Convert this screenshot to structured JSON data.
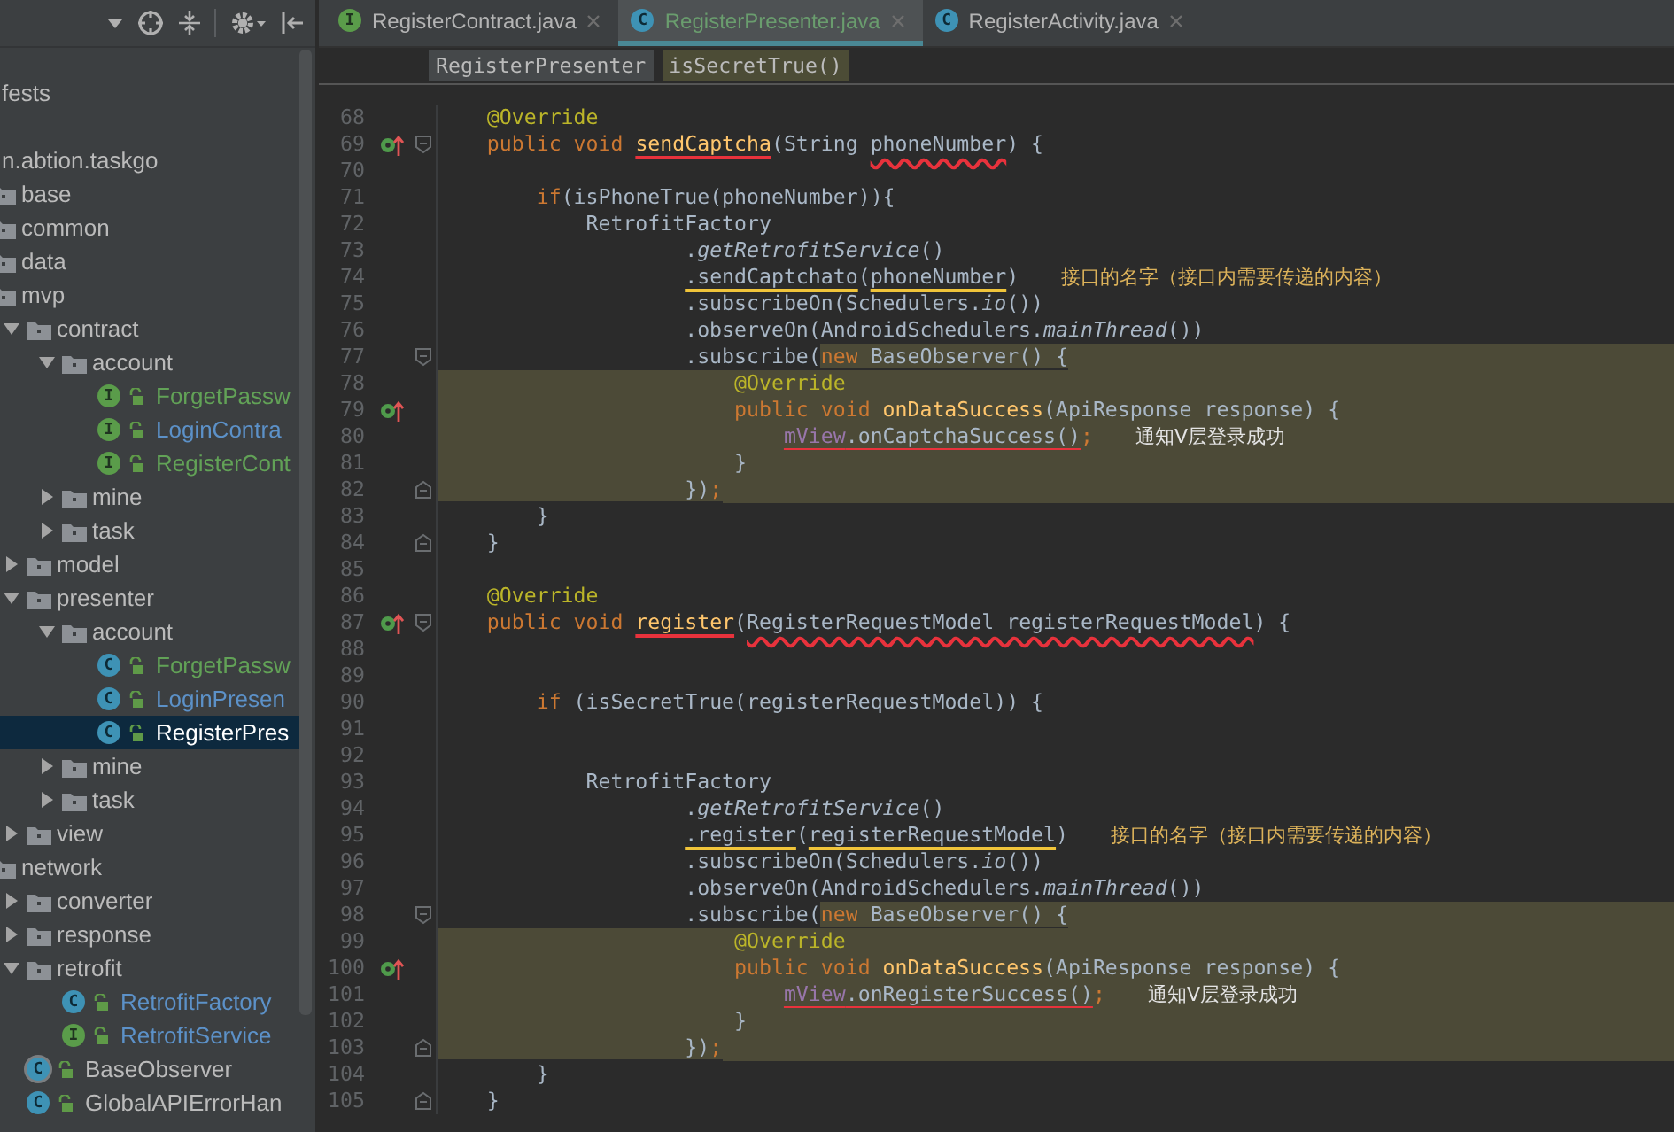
{
  "tree": [
    {
      "label": "fests",
      "kind": "label",
      "selected": false
    },
    {
      "label": "n.abtion.taskgo",
      "kind": "label",
      "selected": false,
      "children": [
        {
          "label": "base",
          "kind": "folder",
          "selected": false
        },
        {
          "label": "common",
          "kind": "folder",
          "selected": false
        },
        {
          "label": "data",
          "kind": "folder",
          "selected": false
        },
        {
          "label": "mvp",
          "kind": "folder",
          "selected": false,
          "children": [
            {
              "label": "contract",
              "kind": "folder",
              "expanded": true,
              "selected": false,
              "children": [
                {
                  "label": "account",
                  "kind": "folder",
                  "expanded": true,
                  "selected": false,
                  "children": [
                    {
                      "label": "ForgetPassw",
                      "kind": "interface",
                      "badge": "I",
                      "color": "#62a257",
                      "selected": false
                    },
                    {
                      "label": "LoginContra",
                      "kind": "interface",
                      "badge": "I",
                      "color": "#5c91c8",
                      "selected": false
                    },
                    {
                      "label": "RegisterCont",
                      "kind": "interface",
                      "badge": "I",
                      "color": "#62a257",
                      "selected": false
                    }
                  ]
                },
                {
                  "label": "mine",
                  "kind": "folder",
                  "expanded": false,
                  "selected": false
                },
                {
                  "label": "task",
                  "kind": "folder",
                  "expanded": false,
                  "selected": false
                }
              ]
            },
            {
              "label": "model",
              "kind": "folder",
              "expanded": false,
              "selected": false
            },
            {
              "label": "presenter",
              "kind": "folder",
              "expanded": true,
              "selected": false,
              "children": [
                {
                  "label": "account",
                  "kind": "folder",
                  "expanded": true,
                  "selected": false,
                  "children": [
                    {
                      "label": "ForgetPassw",
                      "kind": "class",
                      "badge": "C",
                      "color": "#62a257",
                      "selected": false
                    },
                    {
                      "label": "LoginPresen",
                      "kind": "class",
                      "badge": "C",
                      "color": "#5c91c8",
                      "selected": false
                    },
                    {
                      "label": "RegisterPres",
                      "kind": "class",
                      "badge": "C",
                      "color": "#ffffff",
                      "selected": true
                    }
                  ]
                },
                {
                  "label": "mine",
                  "kind": "folder",
                  "expanded": false,
                  "selected": false
                },
                {
                  "label": "task",
                  "kind": "folder",
                  "expanded": false,
                  "selected": false
                }
              ]
            },
            {
              "label": "view",
              "kind": "folder",
              "expanded": false,
              "selected": false
            }
          ]
        },
        {
          "label": "network",
          "kind": "folder",
          "selected": false,
          "children": [
            {
              "label": "converter",
              "kind": "folder",
              "expanded": false,
              "selected": false
            },
            {
              "label": "response",
              "kind": "folder",
              "expanded": false,
              "selected": false
            },
            {
              "label": "retrofit",
              "kind": "folder",
              "expanded": true,
              "selected": false,
              "children": [
                {
                  "label": "RetrofitFactory",
                  "kind": "class",
                  "badge": "C",
                  "color": "#5c91c8",
                  "selected": false
                },
                {
                  "label": "RetrofitService",
                  "kind": "interface",
                  "badge": "I",
                  "color": "#5c91c8",
                  "selected": false
                }
              ]
            },
            {
              "label": "BaseObserver",
              "kind": "abstract",
              "badge": "C",
              "color": "#bbbbbb",
              "selected": false
            },
            {
              "label": "GlobalAPIErrorHan",
              "kind": "class",
              "badge": "C",
              "color": "#bbbbbb",
              "selected": false
            }
          ]
        }
      ]
    }
  ],
  "tabs": [
    {
      "label": "RegisterContract.java",
      "badge": "I",
      "kind": "interface",
      "selected": false
    },
    {
      "label": "RegisterPresenter.java",
      "badge": "C",
      "kind": "class",
      "selected": true
    },
    {
      "label": "RegisterActivity.java",
      "badge": "C",
      "kind": "class",
      "selected": false
    }
  ],
  "breadcrumbs": [
    {
      "label": "RegisterPresenter",
      "kind": "class"
    },
    {
      "label": "isSecretTrue()",
      "kind": "method"
    }
  ],
  "lines": [
    {
      "number": "68",
      "highlighted": false,
      "fold_start": false,
      "fold_end": false,
      "override_mark": false,
      "tokens": [
        {
          "text": "    @Override",
          "kind": "annotation"
        }
      ]
    },
    {
      "number": "69",
      "highlighted": false,
      "fold_start": true,
      "fold_end": false,
      "override_mark": true,
      "tokens": [
        {
          "text": "    public void ",
          "kind": "keyword"
        },
        {
          "text": "sendCaptcha",
          "kind": "declaration",
          "red_underline": true
        },
        {
          "text": "(String ",
          "kind": "plain"
        },
        {
          "text": "phoneNumber",
          "kind": "plain",
          "red_wavy_underline": true
        },
        {
          "text": ") {",
          "kind": "plain"
        }
      ]
    },
    {
      "number": "70",
      "highlighted": false,
      "fold_start": false,
      "fold_end": false,
      "override_mark": false
    },
    {
      "number": "71",
      "highlighted": false,
      "fold_start": false,
      "fold_end": false,
      "override_mark": false,
      "tokens": [
        {
          "text": "        if",
          "kind": "keyword"
        },
        {
          "text": "(isPhoneTrue(phoneNumber)){",
          "kind": "plain"
        }
      ]
    },
    {
      "number": "72",
      "highlighted": false,
      "fold_start": false,
      "fold_end": false,
      "override_mark": false,
      "tokens": [
        {
          "text": "            RetrofitFactory",
          "kind": "plain"
        }
      ]
    },
    {
      "number": "73",
      "highlighted": false,
      "fold_start": false,
      "fold_end": false,
      "override_mark": false,
      "tokens": [
        {
          "text": "                    .",
          "kind": "plain"
        },
        {
          "text": "getRetrofitService",
          "kind": "static"
        },
        {
          "text": "()",
          "kind": "plain"
        }
      ]
    },
    {
      "number": "74",
      "highlighted": false,
      "fold_start": false,
      "fold_end": false,
      "override_mark": false,
      "tokens": [
        {
          "text": "                    .sendCaptchato",
          "kind": "plain",
          "yellow_underline": true
        },
        {
          "text": "(",
          "kind": "plain"
        },
        {
          "text": "phoneNumber",
          "kind": "plain",
          "yellow_underline": true
        },
        {
          "text": ")",
          "kind": "plain"
        }
      ],
      "note": {
        "text": "接口的名字（接口内需要传递的内容）",
        "color": "#dcb25a"
      }
    },
    {
      "number": "75",
      "highlighted": false,
      "fold_start": false,
      "fold_end": false,
      "override_mark": false,
      "tokens": [
        {
          "text": "                    .subscribeOn(Schedulers.",
          "kind": "plain"
        },
        {
          "text": "io",
          "kind": "static"
        },
        {
          "text": "())",
          "kind": "plain"
        }
      ]
    },
    {
      "number": "76",
      "highlighted": false,
      "fold_start": false,
      "fold_end": false,
      "override_mark": false,
      "tokens": [
        {
          "text": "                    .observeOn(AndroidSchedulers.",
          "kind": "plain"
        },
        {
          "text": "mainThread",
          "kind": "static"
        },
        {
          "text": "())",
          "kind": "plain"
        }
      ]
    },
    {
      "number": "77",
      "highlighted": false,
      "fold_start": true,
      "fold_end": false,
      "override_mark": false,
      "tokens": [
        {
          "text": "                    .subscribe(",
          "kind": "plain"
        },
        {
          "text": "new",
          "kind": "keyword",
          "hl": true
        },
        {
          "text": " BaseObserver() {",
          "kind": "plain",
          "hl": true
        }
      ]
    },
    {
      "number": "78",
      "highlighted": true,
      "fold_start": false,
      "fold_end": false,
      "override_mark": false,
      "tokens": [
        {
          "text": "                        @Override",
          "kind": "annotation"
        }
      ]
    },
    {
      "number": "79",
      "highlighted": true,
      "fold_start": false,
      "fold_end": false,
      "override_mark": true,
      "tokens": [
        {
          "text": "                        public void ",
          "kind": "keyword"
        },
        {
          "text": "onDataSuccess",
          "kind": "declaration"
        },
        {
          "text": "(ApiResponse response) {",
          "kind": "plain"
        }
      ]
    },
    {
      "number": "80",
      "highlighted": true,
      "fold_start": false,
      "fold_end": false,
      "override_mark": false,
      "tokens": [
        {
          "text": "                            mView",
          "kind": "field",
          "red_underline": true
        },
        {
          "text": ".onCaptchaSuccess()",
          "kind": "plain",
          "red_underline": true
        },
        {
          "text": ";",
          "kind": "keyword"
        }
      ],
      "note": {
        "text": "通知V层登录成功",
        "color": "#e4e4e4"
      }
    },
    {
      "number": "81",
      "highlighted": true,
      "fold_start": false,
      "fold_end": false,
      "override_mark": false,
      "tokens": [
        {
          "text": "                        }",
          "kind": "plain"
        }
      ]
    },
    {
      "number": "82",
      "highlighted": false,
      "fold_start": false,
      "fold_end": true,
      "override_mark": false,
      "tokens": [
        {
          "text": "                    })",
          "kind": "plain",
          "hl": true
        },
        {
          "text": ";",
          "kind": "keyword",
          "hl": true
        }
      ]
    },
    {
      "number": "83",
      "highlighted": false,
      "fold_start": false,
      "fold_end": false,
      "override_mark": false,
      "tokens": [
        {
          "text": "        }",
          "kind": "plain"
        }
      ]
    },
    {
      "number": "84",
      "highlighted": false,
      "fold_start": false,
      "fold_end": true,
      "override_mark": false,
      "tokens": [
        {
          "text": "    }",
          "kind": "plain"
        }
      ]
    },
    {
      "number": "85",
      "highlighted": false,
      "fold_start": false,
      "fold_end": false,
      "override_mark": false
    },
    {
      "number": "86",
      "highlighted": false,
      "fold_start": false,
      "fold_end": false,
      "override_mark": false,
      "tokens": [
        {
          "text": "    @Override",
          "kind": "annotation"
        }
      ]
    },
    {
      "number": "87",
      "highlighted": false,
      "fold_start": true,
      "fold_end": false,
      "override_mark": true,
      "tokens": [
        {
          "text": "    public void ",
          "kind": "keyword"
        },
        {
          "text": "register",
          "kind": "declaration",
          "red_underline": true
        },
        {
          "text": "(",
          "kind": "plain"
        },
        {
          "text": "RegisterRequestModel registerRequestModel",
          "kind": "plain",
          "red_wavy_underline": true
        },
        {
          "text": ") {",
          "kind": "plain"
        }
      ]
    },
    {
      "number": "88",
      "highlighted": false,
      "fold_start": false,
      "fold_end": false,
      "override_mark": false
    },
    {
      "number": "89",
      "highlighted": false,
      "fold_start": false,
      "fold_end": false,
      "override_mark": false
    },
    {
      "number": "90",
      "highlighted": false,
      "fold_start": false,
      "fold_end": false,
      "override_mark": false,
      "tokens": [
        {
          "text": "        if",
          "kind": "keyword"
        },
        {
          "text": " (isSecretTrue(registerRequestModel)) {",
          "kind": "plain"
        }
      ]
    },
    {
      "number": "91",
      "highlighted": false,
      "fold_start": false,
      "fold_end": false,
      "override_mark": false
    },
    {
      "number": "92",
      "highlighted": false,
      "fold_start": false,
      "fold_end": false,
      "override_mark": false
    },
    {
      "number": "93",
      "highlighted": false,
      "fold_start": false,
      "fold_end": false,
      "override_mark": false,
      "tokens": [
        {
          "text": "            RetrofitFactory",
          "kind": "plain"
        }
      ]
    },
    {
      "number": "94",
      "highlighted": false,
      "fold_start": false,
      "fold_end": false,
      "override_mark": false,
      "tokens": [
        {
          "text": "                    .",
          "kind": "plain"
        },
        {
          "text": "getRetrofitService",
          "kind": "static"
        },
        {
          "text": "()",
          "kind": "plain"
        }
      ]
    },
    {
      "number": "95",
      "highlighted": false,
      "fold_start": false,
      "fold_end": false,
      "override_mark": false,
      "tokens": [
        {
          "text": "                    .register",
          "kind": "plain",
          "yellow_underline": true
        },
        {
          "text": "(",
          "kind": "plain"
        },
        {
          "text": "registerRequestModel",
          "kind": "plain",
          "yellow_underline": true
        },
        {
          "text": ")",
          "kind": "plain"
        }
      ],
      "note": {
        "text": "接口的名字（接口内需要传递的内容）",
        "color": "#dcb25a"
      }
    },
    {
      "number": "96",
      "highlighted": false,
      "fold_start": false,
      "fold_end": false,
      "override_mark": false,
      "tokens": [
        {
          "text": "                    .subscribeOn(Schedulers.",
          "kind": "plain"
        },
        {
          "text": "io",
          "kind": "static"
        },
        {
          "text": "())",
          "kind": "plain"
        }
      ]
    },
    {
      "number": "97",
      "highlighted": false,
      "fold_start": false,
      "fold_end": false,
      "override_mark": false,
      "tokens": [
        {
          "text": "                    .observeOn(AndroidSchedulers.",
          "kind": "plain"
        },
        {
          "text": "mainThread",
          "kind": "static"
        },
        {
          "text": "())",
          "kind": "plain"
        }
      ]
    },
    {
      "number": "98",
      "highlighted": false,
      "fold_start": true,
      "fold_end": false,
      "override_mark": false,
      "tokens": [
        {
          "text": "                    .subscribe(",
          "kind": "plain"
        },
        {
          "text": "new",
          "kind": "keyword",
          "hl": true
        },
        {
          "text": " BaseObserver() {",
          "kind": "plain",
          "hl": true
        }
      ]
    },
    {
      "number": "99",
      "highlighted": true,
      "fold_start": false,
      "fold_end": false,
      "override_mark": false,
      "tokens": [
        {
          "text": "                        @Override",
          "kind": "annotation"
        }
      ]
    },
    {
      "number": "100",
      "highlighted": true,
      "fold_start": false,
      "fold_end": false,
      "override_mark": true,
      "tokens": [
        {
          "text": "                        public void ",
          "kind": "keyword"
        },
        {
          "text": "onDataSuccess",
          "kind": "declaration"
        },
        {
          "text": "(ApiResponse response) {",
          "kind": "plain"
        }
      ]
    },
    {
      "number": "101",
      "highlighted": true,
      "fold_start": false,
      "fold_end": false,
      "override_mark": false,
      "tokens": [
        {
          "text": "                            mView",
          "kind": "field",
          "red_underline": true
        },
        {
          "text": ".onRegisterSuccess()",
          "kind": "plain",
          "red_underline": true
        },
        {
          "text": ";",
          "kind": "keyword"
        }
      ],
      "note": {
        "text": "通知V层登录成功",
        "color": "#e4e4e4"
      }
    },
    {
      "number": "102",
      "highlighted": true,
      "fold_start": false,
      "fold_end": false,
      "override_mark": false,
      "tokens": [
        {
          "text": "                        }",
          "kind": "plain"
        }
      ]
    },
    {
      "number": "103",
      "highlighted": false,
      "fold_start": false,
      "fold_end": true,
      "override_mark": false,
      "tokens": [
        {
          "text": "                    })",
          "kind": "plain",
          "hl": true
        },
        {
          "text": ";",
          "kind": "keyword",
          "hl": true
        }
      ]
    },
    {
      "number": "104",
      "highlighted": false,
      "fold_start": false,
      "fold_end": false,
      "override_mark": false,
      "tokens": [
        {
          "text": "        }",
          "kind": "plain"
        }
      ]
    },
    {
      "number": "105",
      "highlighted": false,
      "fold_start": false,
      "fold_end": true,
      "override_mark": false,
      "tokens": [
        {
          "text": "    }",
          "kind": "plain"
        }
      ]
    }
  ]
}
